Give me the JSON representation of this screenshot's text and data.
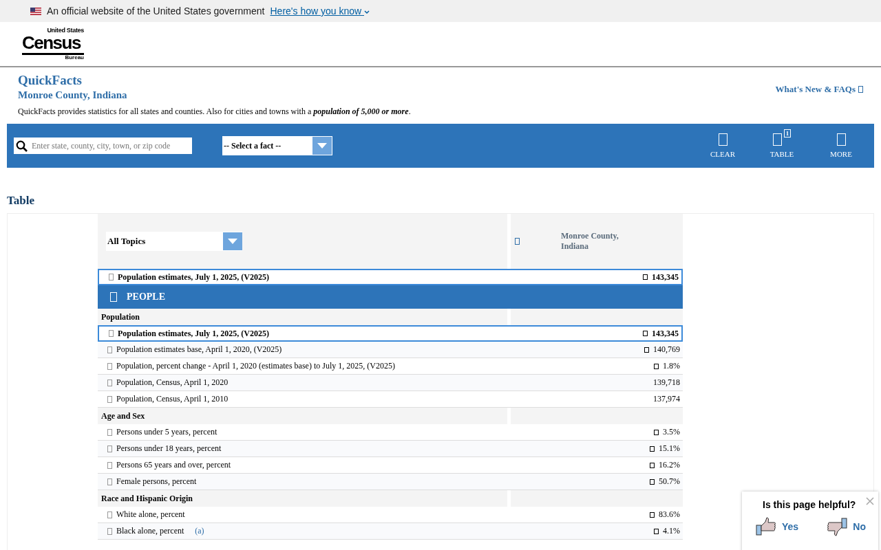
{
  "banner": {
    "text": "An official website of the United States government",
    "link": "Here's how you know"
  },
  "logo": {
    "top": "United States",
    "main": "Census",
    "bottom": "Bureau"
  },
  "header": {
    "title": "QuickFacts",
    "subtitle": "Monroe County, Indiana",
    "description": "QuickFacts provides statistics for all states and counties. Also for cities and towns with a **population of 5,000 or more**.",
    "whats_new": "What's New & FAQs"
  },
  "toolbar": {
    "search": {
      "placeholder": "Enter state, county, city, town, or zip code"
    },
    "fact_select": "-- Select a fact --",
    "actions": [
      {
        "label": "CLEAR"
      },
      {
        "label": "TABLE",
        "badge": "1"
      },
      {
        "label": "MORE"
      }
    ]
  },
  "section_title": "Table",
  "table": {
    "topic_select": "All Topics",
    "column_header": "Monroe County, Indiana",
    "pinned_row": {
      "label": "Population estimates, July 1, 2025, (V2025)",
      "value": "143,345"
    },
    "groups": [
      {
        "title": "PEOPLE",
        "subgroups": [
          {
            "title": "Population",
            "rows": [
              {
                "label": "Population estimates, July 1, 2025, (V2025)",
                "value": "143,345",
                "selected": true,
                "info_icon": true
              },
              {
                "label": "Population estimates base, April 1, 2020, (V2025)",
                "value": "140,769",
                "selected": false,
                "info_icon": true
              },
              {
                "label": "Population, percent change - April 1, 2020 (estimates base) to July 1, 2025, (V2025)",
                "value": "1.8%",
                "selected": false,
                "info_icon": true
              },
              {
                "label": "Population, Census, April 1, 2020",
                "value": "139,718",
                "selected": false,
                "info_icon": false
              },
              {
                "label": "Population, Census, April 1, 2010",
                "value": "137,974",
                "selected": false,
                "info_icon": false
              }
            ]
          },
          {
            "title": "Age and Sex",
            "rows": [
              {
                "label": "Persons under 5 years, percent",
                "value": "3.5%",
                "selected": false,
                "info_icon": true
              },
              {
                "label": "Persons under 18 years, percent",
                "value": "15.1%",
                "selected": false,
                "info_icon": true
              },
              {
                "label": "Persons 65 years and over, percent",
                "value": "16.2%",
                "selected": false,
                "info_icon": true
              },
              {
                "label": "Female persons, percent",
                "value": "50.7%",
                "selected": false,
                "info_icon": true
              }
            ]
          },
          {
            "title": "Race and Hispanic Origin",
            "rows": [
              {
                "label": "White alone, percent",
                "value": "83.6%",
                "selected": false,
                "info_icon": true
              },
              {
                "label": "Black alone, percent",
                "footnote": "(a)",
                "value": "4.1%",
                "selected": false,
                "info_icon": true
              }
            ]
          }
        ]
      }
    ]
  },
  "feedback": {
    "question": "Is this page helpful?",
    "yes": "Yes",
    "no": "No"
  }
}
